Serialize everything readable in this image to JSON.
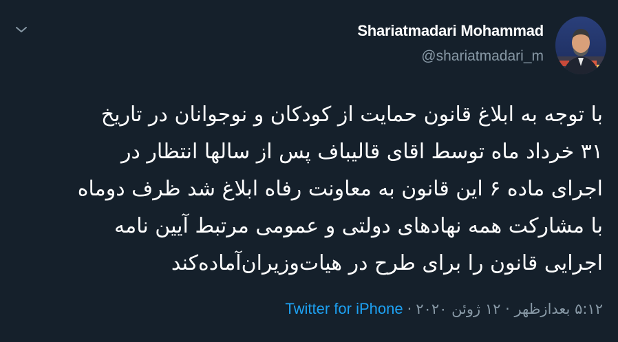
{
  "tweet": {
    "display_name": "Shariatmadari Mohammad",
    "handle": "@shariatmadari_m",
    "body_lines": [
      "با توجه به ابلاغ قانون حمایت از کودکان و نوجوانان در تاریخ",
      "۳۱ خرداد ماه توسط اقای قالیباف پس از سالها انتظار در",
      "اجرای ماده ۶ این قانون به معاونت رفاه ابلاغ شد ظرف دوماه",
      "با مشارکت همه نهادهای دولتی و عمومی مرتبط آیین نامه",
      "اجرایی قانون را برای طرح در هیات‌وزیران‌آماده‌کند"
    ],
    "timestamp": "۵:۱۲ بعدازظهر · ۱۲ ژوئن ۲۰۲۰",
    "separator": "·",
    "source": "Twitter for iPhone"
  },
  "icons": {
    "menu": "chevron-down-icon",
    "avatar": "profile-photo"
  },
  "colors": {
    "background": "#15202b",
    "primary_text": "#ffffff",
    "secondary_text": "#8899a6",
    "link": "#1da1f2"
  }
}
